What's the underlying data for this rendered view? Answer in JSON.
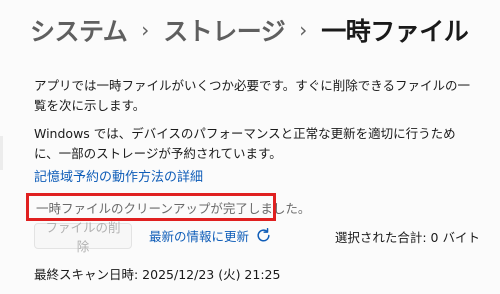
{
  "breadcrumb": {
    "items": [
      "システム",
      "ストレージ",
      "一時ファイル"
    ],
    "separator": "›"
  },
  "description": {
    "para1": "アプリでは一時ファイルがいくつか必要です。すぐに削除できるファイルの一覧を次に示します。",
    "para2": "Windows では、デバイスのパフォーマンスと正常な更新を適切に行うために、一部のストレージが予約されています。"
  },
  "storage_reserve_link": "記憶域予約の動作方法の詳細",
  "status_message": "一時ファイルのクリーンアップが完了しました。",
  "actions": {
    "delete_label": "ファイルの削除",
    "refresh_label": "最新の情報に更新",
    "refresh_icon": "refresh-icon"
  },
  "selected_total": "選択された合計: 0 バイト",
  "last_scan": "最終スキャン日時: 2025/12/23 (火) 21:25",
  "colors": {
    "accent": "#0f5db8",
    "highlight_border": "#e02020"
  }
}
